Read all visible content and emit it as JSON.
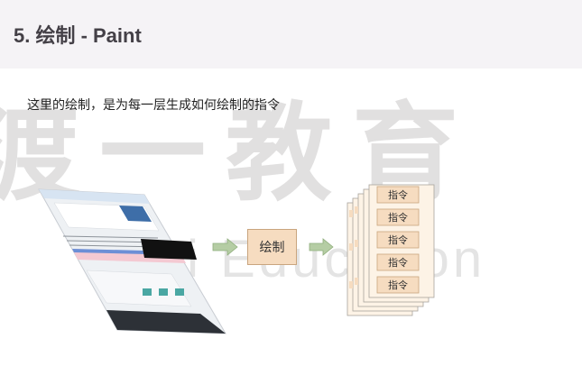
{
  "header": {
    "title": "5. 绘制 - Paint"
  },
  "body": {
    "description": "这里的绘制，是为每一层生成如何绘制的指令"
  },
  "watermark": {
    "chinese": "渡一教育",
    "english": "Duyi Education"
  },
  "diagram": {
    "paint_label": "绘制",
    "instructions": [
      "指令",
      "指令",
      "指令",
      "指令",
      "指令"
    ]
  },
  "colors": {
    "header_bg": "#f5f3f6",
    "box_fill": "#f6dcc0",
    "arrow": "#b5cda4",
    "stack_fill": "#fdf3e6"
  }
}
